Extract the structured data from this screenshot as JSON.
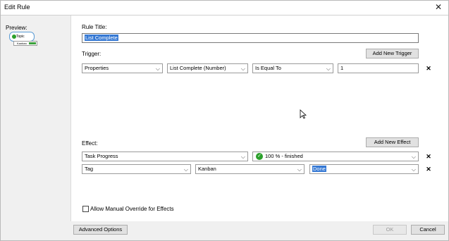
{
  "window": {
    "title": "Edit Rule",
    "close_glyph": "✕"
  },
  "preview": {
    "label": "Preview:",
    "card_text": "Topic",
    "sub_text": "Kanban"
  },
  "rule_title": {
    "label": "Rule Title:",
    "value": "List Complete"
  },
  "trigger": {
    "label": "Trigger:",
    "add_button": "Add New Trigger",
    "row": {
      "type": "Properties",
      "property": "List Complete (Number)",
      "operator": "Is Equal To",
      "value": "1"
    }
  },
  "effect": {
    "label": "Effect:",
    "add_button": "Add New Effect",
    "rows": [
      {
        "type": "Task Progress",
        "value": "100 % - finished"
      },
      {
        "type": "Tag",
        "group": "Kanban",
        "value": "Done"
      }
    ]
  },
  "allow_override": {
    "label": "Allow Manual Override for Effects",
    "checked": false
  },
  "buttons": {
    "advanced": "Advanced Options",
    "ok": "OK",
    "cancel": "Cancel"
  },
  "icons": {
    "dropdown": "chevron-down-icon",
    "delete": "✕"
  }
}
